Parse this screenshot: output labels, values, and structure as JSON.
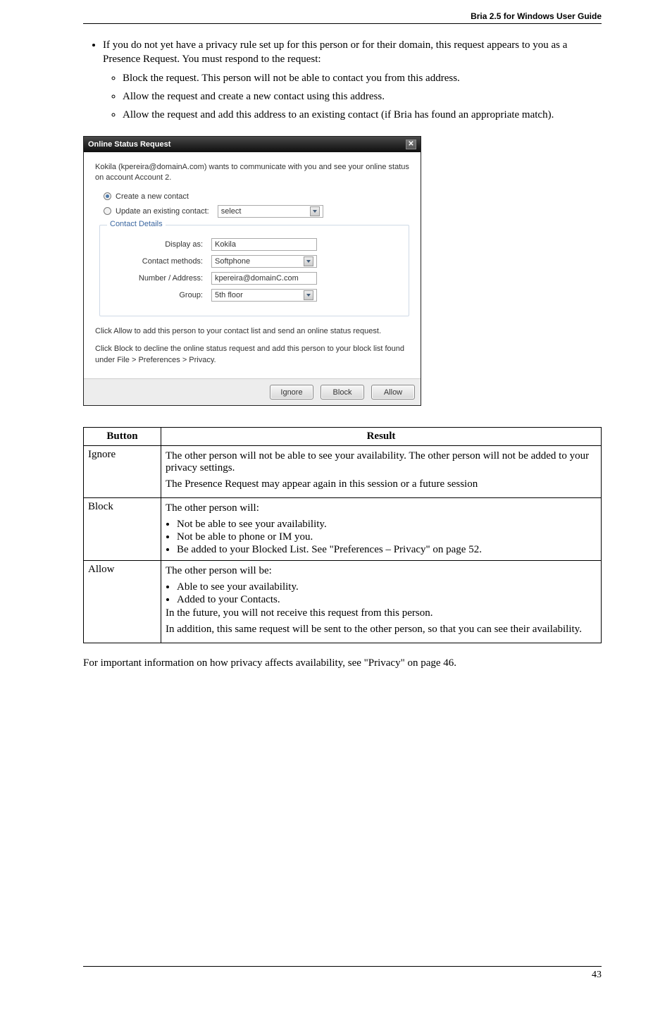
{
  "header": {
    "title": "Bria 2.5 for Windows User Guide"
  },
  "intro_list": {
    "item1": "If you do not yet have a privacy rule set up for this person or for their domain, this request appears to you as a Presence Request. You must respond to the request:",
    "sub1": "Block the request. This person will not be able to contact you from this address.",
    "sub2": "Allow the request and create a new contact using this address.",
    "sub3": "Allow the request and add this address to an existing contact (if Bria has found an appropriate match)."
  },
  "dialog": {
    "title": "Online Status Request",
    "intro": "Kokila (kpereira@domainA.com) wants to communicate with you and see your online status on account Account 2.",
    "radio_create": "Create a new contact",
    "radio_update": "Update an existing contact:",
    "update_value": "select",
    "legend": "Contact Details",
    "labels": {
      "display_as": "Display as:",
      "contact_methods": "Contact methods:",
      "number_address": "Number / Address:",
      "group": "Group:"
    },
    "values": {
      "display_as": "Kokila",
      "contact_methods": "Softphone",
      "number_address": "kpereira@domainC.com",
      "group": "5th floor"
    },
    "instructions1": "Click Allow to add this person to your contact list and send an online status request.",
    "instructions2": "Click Block to decline the online status request and add this person to your block list found under File > Preferences > Privacy.",
    "buttons": {
      "ignore": "Ignore",
      "block": "Block",
      "allow": "Allow"
    }
  },
  "table": {
    "headers": {
      "button": "Button",
      "result": "Result"
    },
    "rows": {
      "ignore": {
        "label": "Ignore",
        "p1": "The other person will not be able to see your availability. The other person will not be added to your privacy settings.",
        "p2": "The Presence Request may appear again in this session or a future session"
      },
      "block": {
        "label": "Block",
        "lead": "The other person will:",
        "b1": "Not be able to see your availability.",
        "b2": "Not be able to phone or IM you.",
        "b3": "Be added to your Blocked List. See \"Preferences – Privacy\" on page 52."
      },
      "allow": {
        "label": "Allow",
        "lead": "The other person will be:",
        "b1": "Able to see your availability.",
        "b2": "Added to your Contacts.",
        "p1": "In the future, you will not receive this request from this person.",
        "p2": "In addition, this same request will be sent to the other person, so that you can see their availability."
      }
    }
  },
  "closing": "For important information on how privacy affects availability, see \"Privacy\" on page 46.",
  "page_number": "43"
}
